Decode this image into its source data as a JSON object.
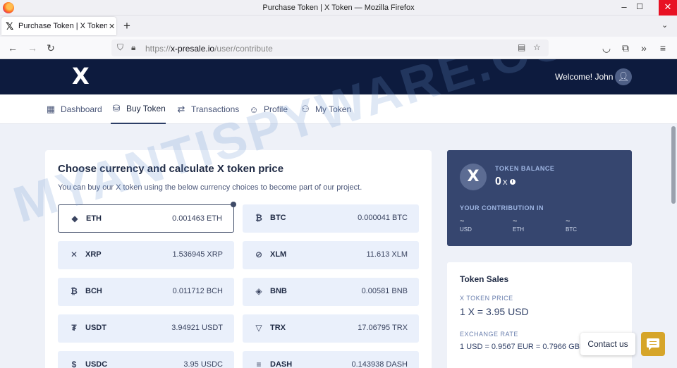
{
  "window": {
    "title": "Purchase Token | X Token — Mozilla Firefox"
  },
  "tab": {
    "title": "Purchase Token | X Token",
    "icon": "x-logo-icon"
  },
  "address_bar": {
    "scheme": "https://",
    "domain": "x-presale.io",
    "path": "/user/contribute"
  },
  "header": {
    "logo": "X",
    "welcome": "Welcome! John"
  },
  "nav": [
    {
      "label": "Dashboard",
      "icon": "dashboard-icon"
    },
    {
      "label": "Buy Token",
      "icon": "coins-icon",
      "active": true
    },
    {
      "label": "Transactions",
      "icon": "arrows-icon"
    },
    {
      "label": "Profile",
      "icon": "profile-icon"
    },
    {
      "label": "My Token",
      "icon": "users-icon"
    }
  ],
  "buy": {
    "title": "Choose currency and calculate X token price",
    "subtitle": "You can buy our X token using the below currency choices to become part of our project.",
    "currencies": [
      {
        "name": "ETH",
        "value": "0.001463 ETH",
        "icon": "eth-icon",
        "glyph": "◆",
        "selected": true
      },
      {
        "name": "BTC",
        "value": "0.000041 BTC",
        "icon": "btc-icon",
        "glyph": "₿"
      },
      {
        "name": "XRP",
        "value": "1.536945 XRP",
        "icon": "xrp-icon",
        "glyph": "✕"
      },
      {
        "name": "XLM",
        "value": "11.613 XLM",
        "icon": "xlm-icon",
        "glyph": "⊘"
      },
      {
        "name": "BCH",
        "value": "0.011712 BCH",
        "icon": "bch-icon",
        "glyph": "₿"
      },
      {
        "name": "BNB",
        "value": "0.00581 BNB",
        "icon": "bnb-icon",
        "glyph": "◈"
      },
      {
        "name": "USDT",
        "value": "3.94921 USDT",
        "icon": "usdt-icon",
        "glyph": "₮"
      },
      {
        "name": "TRX",
        "value": "17.06795 TRX",
        "icon": "trx-icon",
        "glyph": "▽"
      },
      {
        "name": "USDC",
        "value": "3.95 USDC",
        "icon": "usdc-icon",
        "glyph": "$"
      },
      {
        "name": "DASH",
        "value": "0.143938 DASH",
        "icon": "dash-icon",
        "glyph": "≡"
      }
    ]
  },
  "balance": {
    "label": "TOKEN BALANCE",
    "value": "0",
    "unit": "X",
    "contribution_label": "YOUR CONTRIBUTION IN",
    "contributions": [
      {
        "value": "~",
        "unit": "USD"
      },
      {
        "value": "~",
        "unit": "ETH"
      },
      {
        "value": "~",
        "unit": "BTC"
      }
    ]
  },
  "sales": {
    "title": "Token Sales",
    "price_label": "X TOKEN PRICE",
    "price": "1 X = 3.95 USD",
    "rate_label": "EXCHANGE RATE",
    "rate": "1 USD = 0.9567 EUR = 0.7966 GBP"
  },
  "contact": {
    "label": "Contact us"
  },
  "watermark": "MYANTISPYWARE.COM"
}
